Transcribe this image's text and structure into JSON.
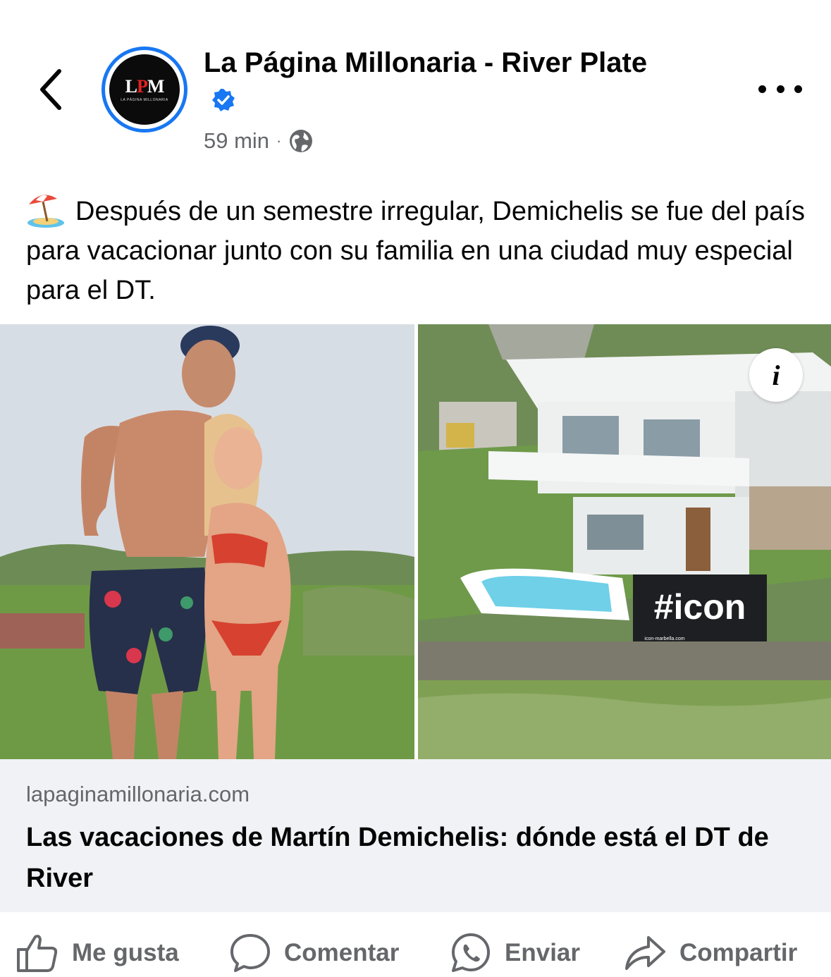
{
  "header": {
    "back_icon": "chevron-left-icon",
    "page_name": "La Página Millonaria - River Plate",
    "avatar_logo": "LPM",
    "avatar_sub": "LA PÁGINA MILLONARIA",
    "verified_icon": "verified-badge-icon",
    "time": "59 min",
    "separator": "·",
    "audience_icon": "globe-icon",
    "more_icon": "more-horizontal-icon"
  },
  "post": {
    "emoji_icon": "beach-umbrella-emoji",
    "text": "Después de un semestre irregular, Demichelis se fue del país para vacacionar junto con su familia en una ciudad muy especial para el DT."
  },
  "media": {
    "sign_text": "#icon",
    "sign_subtext": "icon-marbella.com",
    "info_label": "i"
  },
  "link_preview": {
    "domain": "lapaginamillonaria.com",
    "title": "Las vacaciones de Martín Demichelis: dónde está el DT de River"
  },
  "actions": [
    {
      "label": "Me gusta",
      "icon": "like-icon"
    },
    {
      "label": "Comentar",
      "icon": "comment-icon"
    },
    {
      "label": "Enviar",
      "icon": "whatsapp-icon"
    },
    {
      "label": "Compartir",
      "icon": "share-icon"
    }
  ],
  "colors": {
    "verified_blue": "#1877f2",
    "secondary_text": "#65676b",
    "link_bg": "#f0f2f5"
  }
}
